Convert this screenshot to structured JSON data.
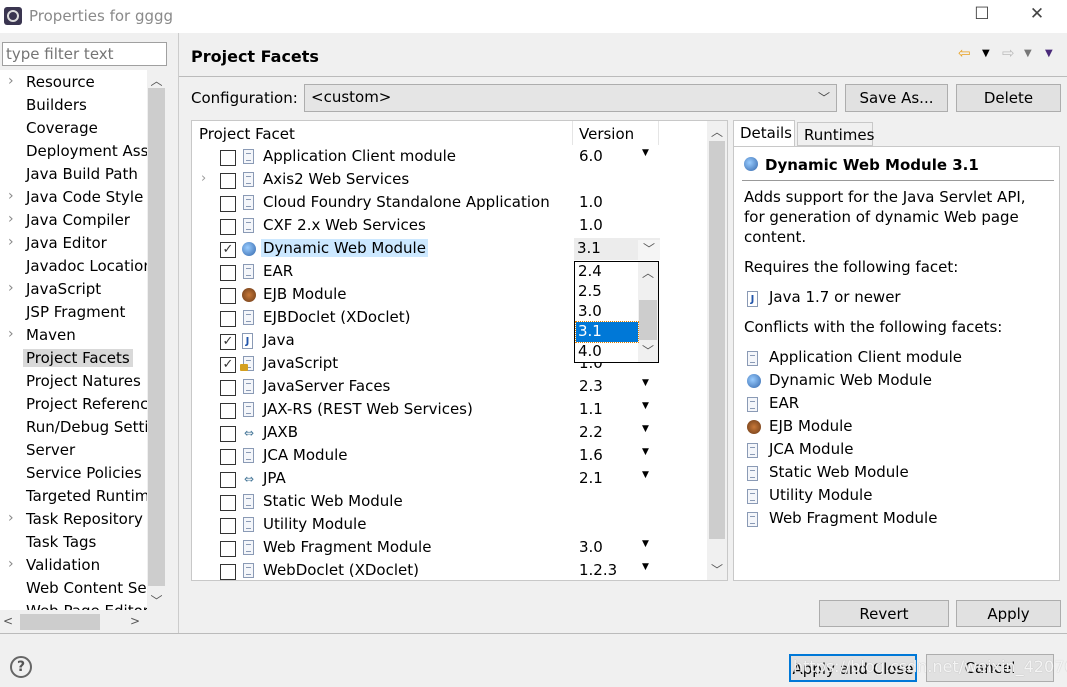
{
  "window": {
    "title": "Properties for gggg",
    "minimize": "—",
    "maximize": "☐",
    "close": "✕"
  },
  "filter": {
    "placeholder": "type filter text"
  },
  "tree": {
    "items": [
      {
        "label": "Resource",
        "expandable": true
      },
      {
        "label": "Builders"
      },
      {
        "label": "Coverage"
      },
      {
        "label": "Deployment Assembly"
      },
      {
        "label": "Java Build Path"
      },
      {
        "label": "Java Code Style",
        "expandable": true
      },
      {
        "label": "Java Compiler",
        "expandable": true
      },
      {
        "label": "Java Editor",
        "expandable": true
      },
      {
        "label": "Javadoc Location"
      },
      {
        "label": "JavaScript",
        "expandable": true
      },
      {
        "label": "JSP Fragment"
      },
      {
        "label": "Maven",
        "expandable": true
      },
      {
        "label": "Project Facets",
        "selected": true
      },
      {
        "label": "Project Natures"
      },
      {
        "label": "Project References"
      },
      {
        "label": "Run/Debug Settings"
      },
      {
        "label": "Server"
      },
      {
        "label": "Service Policies"
      },
      {
        "label": "Targeted Runtimes"
      },
      {
        "label": "Task Repository",
        "expandable": true
      },
      {
        "label": "Task Tags"
      },
      {
        "label": "Validation",
        "expandable": true
      },
      {
        "label": "Web Content Settings"
      },
      {
        "label": "Web Page Editor"
      }
    ]
  },
  "header": {
    "title": "Project Facets"
  },
  "config": {
    "label": "Configuration:",
    "value": "<custom>",
    "save_as": "Save As...",
    "delete": "Delete"
  },
  "table": {
    "col_facet": "Project Facet",
    "col_version": "Version",
    "rows": [
      {
        "name": "Application Client module",
        "version": "6.0",
        "dropdown": true,
        "checked": false,
        "icon": "doc"
      },
      {
        "name": "Axis2 Web Services",
        "version": "",
        "checked": false,
        "icon": "doc",
        "expandable": true
      },
      {
        "name": "Cloud Foundry Standalone Application",
        "version": "1.0",
        "checked": false,
        "icon": "doc"
      },
      {
        "name": "CXF 2.x Web Services",
        "version": "1.0",
        "checked": false,
        "icon": "doc"
      },
      {
        "name": "Dynamic Web Module",
        "version": "3.1",
        "checked": true,
        "icon": "globe",
        "selected": true
      },
      {
        "name": "EAR",
        "version": "",
        "checked": false,
        "icon": "doc"
      },
      {
        "name": "EJB Module",
        "version": "",
        "checked": false,
        "icon": "bean"
      },
      {
        "name": "EJBDoclet (XDoclet)",
        "version": "",
        "checked": false,
        "icon": "doc"
      },
      {
        "name": "Java",
        "version": "",
        "checked": true,
        "icon": "java"
      },
      {
        "name": "JavaScript",
        "version": "1.0",
        "checked": true,
        "icon": "lockdoc"
      },
      {
        "name": "JavaServer Faces",
        "version": "2.3",
        "dropdown": true,
        "checked": false,
        "icon": "doc"
      },
      {
        "name": "JAX-RS (REST Web Services)",
        "version": "1.1",
        "dropdown": true,
        "checked": false,
        "icon": "doc"
      },
      {
        "name": "JAXB",
        "version": "2.2",
        "dropdown": true,
        "checked": false,
        "icon": "arrows"
      },
      {
        "name": "JCA Module",
        "version": "1.6",
        "dropdown": true,
        "checked": false,
        "icon": "doc"
      },
      {
        "name": "JPA",
        "version": "2.1",
        "dropdown": true,
        "checked": false,
        "icon": "arrows"
      },
      {
        "name": "Static Web Module",
        "version": "",
        "checked": false,
        "icon": "doc"
      },
      {
        "name": "Utility Module",
        "version": "",
        "checked": false,
        "icon": "doc"
      },
      {
        "name": "Web Fragment Module",
        "version": "3.0",
        "dropdown": true,
        "checked": false,
        "icon": "doc"
      },
      {
        "name": "WebDoclet (XDoclet)",
        "version": "1.2.3",
        "dropdown": true,
        "checked": false,
        "icon": "doc"
      }
    ]
  },
  "version_popup": {
    "current": "3.1",
    "options": [
      "2.4",
      "2.5",
      "3.0",
      "3.1",
      "4.0"
    ],
    "selected": "3.1"
  },
  "details": {
    "tabs": [
      "Details",
      "Runtimes"
    ],
    "active_tab": "Details",
    "title": "Dynamic Web Module 3.1",
    "description": [
      "Adds support for the Java Servlet API,",
      "for generation of dynamic Web page",
      "content."
    ],
    "requires_label": "Requires the following facet:",
    "requires": [
      {
        "label": "Java 1.7 or newer",
        "icon": "java"
      }
    ],
    "conflicts_label": "Conflicts with the following facets:",
    "conflicts": [
      {
        "label": "Application Client module",
        "icon": "doc"
      },
      {
        "label": "Dynamic Web Module",
        "icon": "globe"
      },
      {
        "label": "EAR",
        "icon": "doc"
      },
      {
        "label": "EJB Module",
        "icon": "bean"
      },
      {
        "label": "JCA Module",
        "icon": "doc"
      },
      {
        "label": "Static Web Module",
        "icon": "doc"
      },
      {
        "label": "Utility Module",
        "icon": "doc"
      },
      {
        "label": "Web Fragment Module",
        "icon": "doc"
      }
    ]
  },
  "buttons": {
    "revert": "Revert",
    "apply": "Apply",
    "apply_close": "Apply and Close",
    "cancel": "Cancel"
  },
  "watermark": "https://blog.csdn.net/weixin_42076497",
  "colors": {
    "selection": "#0078d7",
    "row_highlight": "#cce8ff",
    "back_arrow": "#e8a020"
  }
}
